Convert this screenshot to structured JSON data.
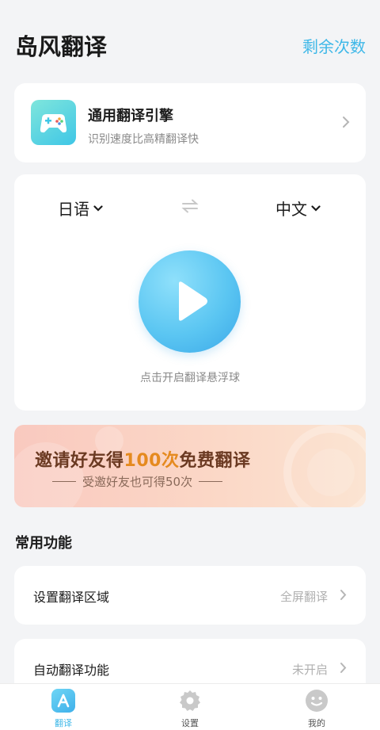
{
  "header": {
    "app_title": "岛风翻译",
    "remaining_label": "剩余次数"
  },
  "engine": {
    "title": "通用翻译引擎",
    "subtitle": "识别速度比高精翻译快",
    "icon": "gamepad-icon"
  },
  "translator": {
    "source_lang": "日语",
    "target_lang": "中文",
    "hint": "点击开启翻译悬浮球"
  },
  "banner": {
    "title_prefix": "邀请好友得",
    "title_highlight": "100次",
    "title_suffix": "免费翻译",
    "subtitle": "受邀好友也可得50次"
  },
  "features": {
    "section_title": "常用功能",
    "items": [
      {
        "label": "设置翻译区域",
        "value": "全屏翻译"
      },
      {
        "label": "自动翻译功能",
        "value": "未开启"
      }
    ]
  },
  "tabbar": {
    "tabs": [
      {
        "label": "翻译",
        "icon": "translate-icon",
        "active": true
      },
      {
        "label": "设置",
        "icon": "gear-icon",
        "active": false
      },
      {
        "label": "我的",
        "icon": "smiley-icon",
        "active": false
      }
    ]
  },
  "colors": {
    "accent": "#3fb8e8",
    "banner_highlight": "#e58a1f"
  }
}
